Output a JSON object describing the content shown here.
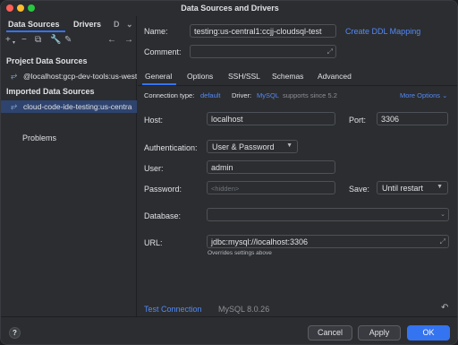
{
  "window": {
    "title": "Data Sources and Drivers"
  },
  "left": {
    "tabs": {
      "data_sources": "Data Sources",
      "drivers": "Drivers",
      "more": "D"
    },
    "toolbar_icons": [
      "plus-icon",
      "minus-icon",
      "duplicate-icon",
      "settings-icon",
      "edit-icon",
      "back-icon",
      "forward-icon"
    ],
    "project_header": "Project Data Sources",
    "project_item": "@localhost:gcp-dev-tools:us-west",
    "imported_header": "Imported Data Sources",
    "imported_item": "cloud-code-ide-testing:us-centra",
    "problems": "Problems"
  },
  "right": {
    "name_label": "Name:",
    "name_value": "testing:us-central1:ccjj-cloudsql-test",
    "create_ddl": "Create DDL Mapping",
    "comment_label": "Comment:",
    "comment_value": "",
    "tabs": [
      "General",
      "Options",
      "SSH/SSL",
      "Schemas",
      "Advanced"
    ],
    "conn_type_label": "Connection type:",
    "conn_type_value": "default",
    "driver_label": "Driver:",
    "driver_value": "MySQL",
    "driver_note": "supports since 5.2",
    "more_options": "More Options",
    "host_label": "Host:",
    "host_value": "localhost",
    "port_label": "Port:",
    "port_value": "3306",
    "auth_label": "Authentication:",
    "auth_value": "User & Password",
    "user_label": "User:",
    "user_value": "admin",
    "password_label": "Password:",
    "password_placeholder": "<hidden>",
    "save_label": "Save:",
    "save_value": "Until restart",
    "database_label": "Database:",
    "database_value": "",
    "url_label": "URL:",
    "url_value": "jdbc:mysql://localhost:3306",
    "url_hint": "Overrides settings above",
    "test_connection": "Test Connection",
    "mysql_version": "MySQL 8.0.26"
  },
  "buttons": {
    "help": "?",
    "cancel": "Cancel",
    "apply": "Apply",
    "ok": "OK"
  },
  "colors": {
    "accent": "#3574f0",
    "link": "#548af7",
    "background": "#2b2d30"
  }
}
